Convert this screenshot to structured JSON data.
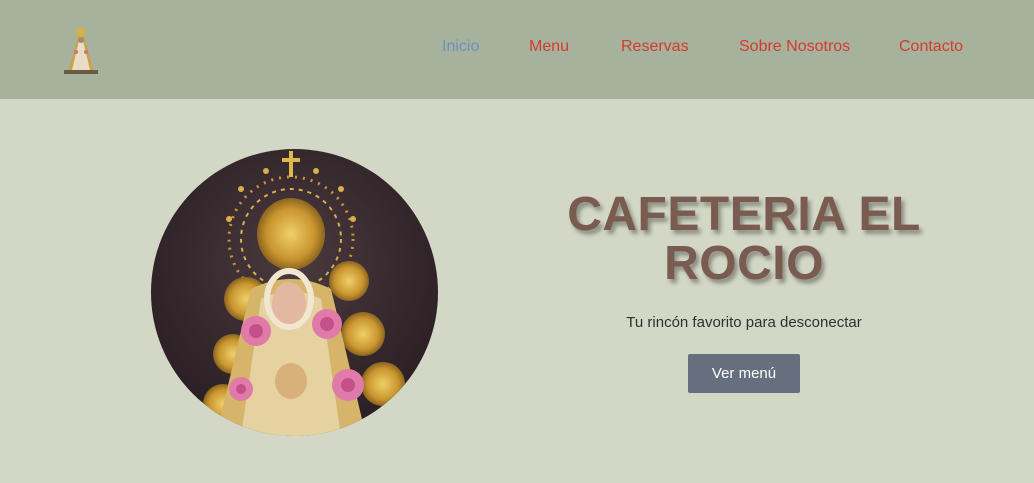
{
  "header": {
    "logo_icon": "virgin-statue-logo-icon",
    "nav": [
      {
        "label": "Inicio",
        "active": true
      },
      {
        "label": "Menu",
        "active": false
      },
      {
        "label": "Reservas",
        "active": false
      },
      {
        "label": "Sobre Nosotros",
        "active": false
      },
      {
        "label": "Contacto",
        "active": false
      }
    ]
  },
  "hero": {
    "image_icon": "virgin-statue-image",
    "title_line1": "CAFETERIA EL",
    "title_line2": "ROCIO",
    "subtitle": "Tu rincón favorito para desconectar",
    "cta_label": "Ver menú"
  },
  "colors": {
    "header_bg": "#a6b29b",
    "page_bg": "#d3d8c6",
    "nav_link": "#d63a2f",
    "nav_active": "#6f8fc4",
    "title": "#7a5b4f",
    "button_bg": "#676f7e"
  }
}
